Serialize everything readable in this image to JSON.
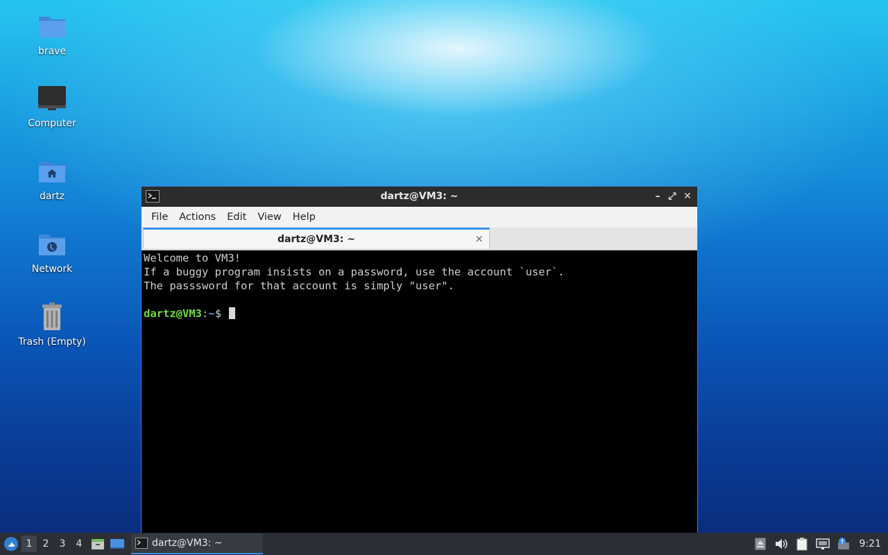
{
  "desktop": {
    "icons": [
      {
        "label": "brave",
        "icon": "folder-icon"
      },
      {
        "label": "Computer",
        "icon": "computer-icon"
      },
      {
        "label": "dartz",
        "icon": "home-folder-icon"
      },
      {
        "label": "Network",
        "icon": "network-folder-icon"
      },
      {
        "label": "Trash (Empty)",
        "icon": "trash-icon"
      }
    ]
  },
  "window": {
    "title": "dartz@VM3: ~",
    "menu": [
      "File",
      "Actions",
      "Edit",
      "View",
      "Help"
    ],
    "tab_label": "dartz@VM3: ~",
    "tab_close": "×",
    "controls": {
      "minimize": "–",
      "maximize": "⤢",
      "close": "✕"
    }
  },
  "terminal": {
    "lines": [
      "Welcome to VM3!",
      "If a buggy program insists on a password, use the account `user`.",
      "The passsword for that account is simply \"user\"."
    ],
    "prompt_user": "dartz@VM3",
    "prompt_sep": ":",
    "prompt_path": "~",
    "prompt_symbol": "$ "
  },
  "taskbar": {
    "workspaces": [
      "1",
      "2",
      "3",
      "4"
    ],
    "active_workspace": "1",
    "task_label": "dartz@VM3: ~",
    "clock": "9:21"
  },
  "colors": {
    "accent": "#3a8ee6",
    "prompt_user": "#6ddc3b",
    "prompt_path": "#6b8cff"
  }
}
